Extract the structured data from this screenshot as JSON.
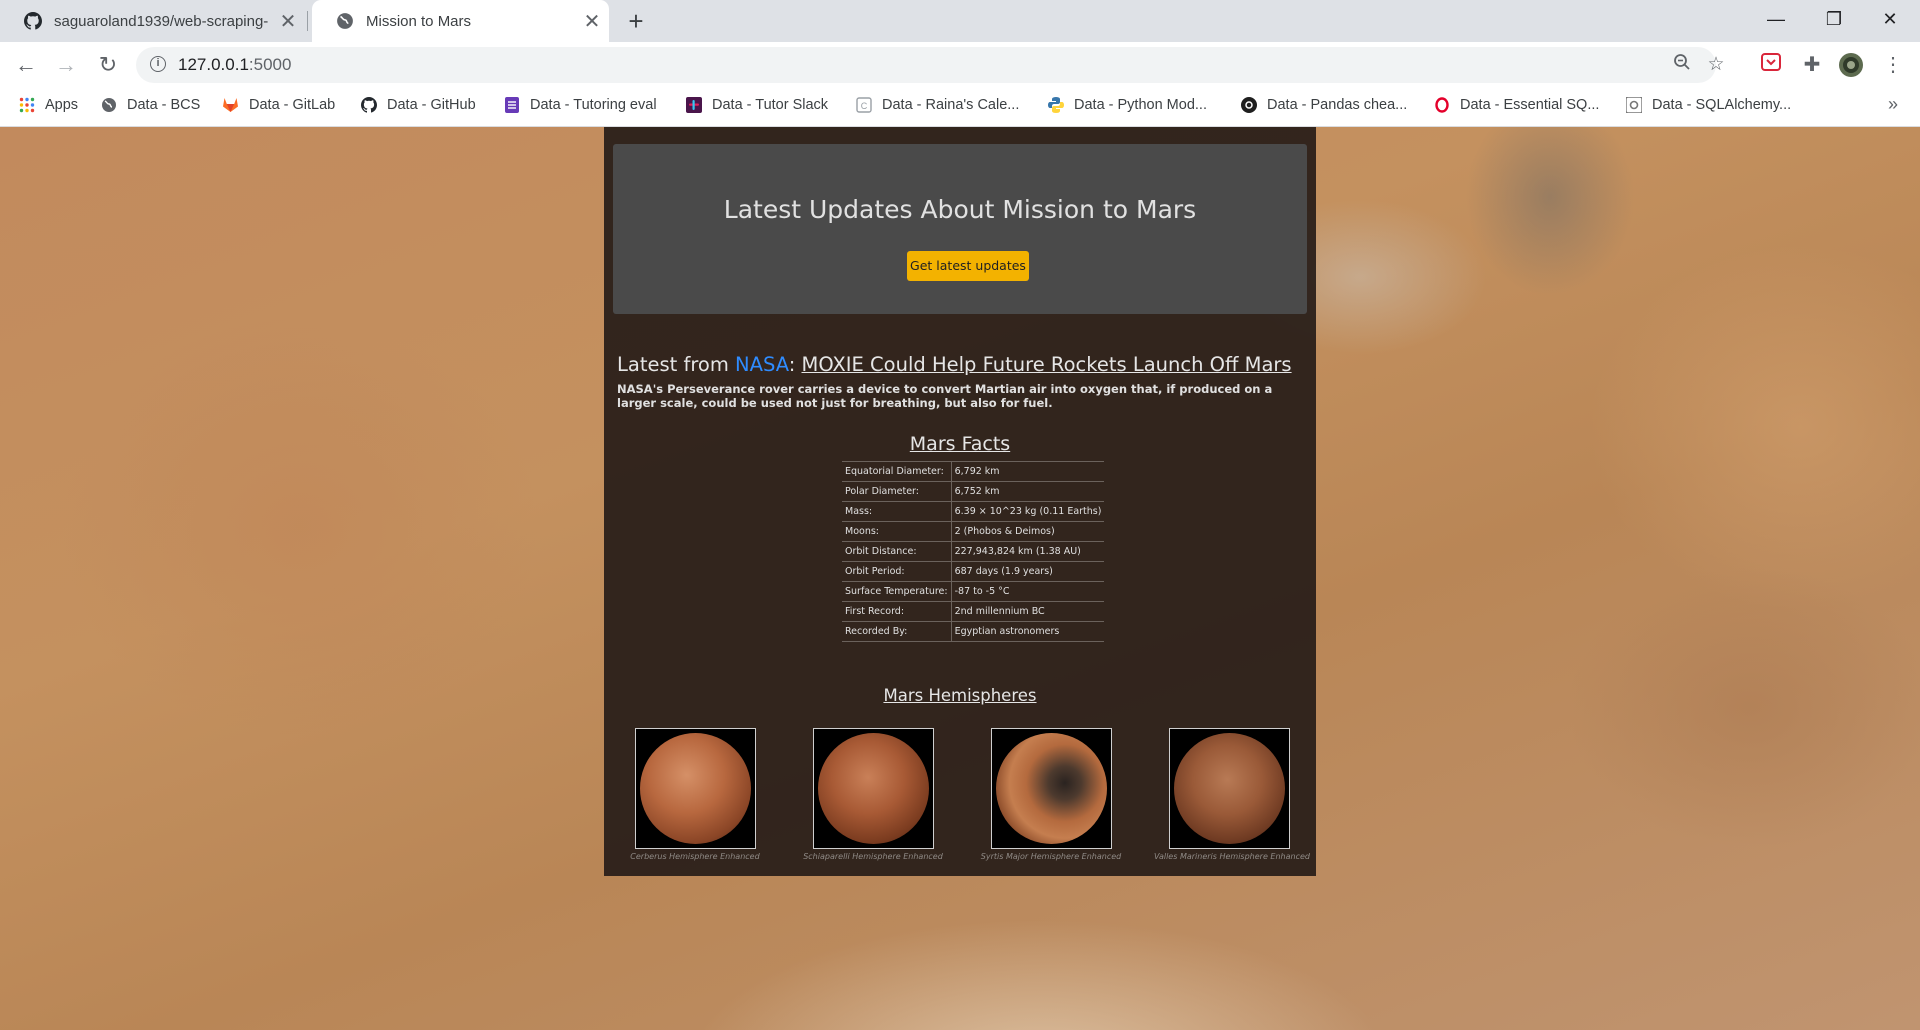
{
  "browser": {
    "tabs": [
      {
        "title": "saguaroland1939/web-scraping-",
        "icon": "github-icon",
        "active": false
      },
      {
        "title": "Mission to Mars",
        "icon": "globe-icon",
        "active": true
      }
    ],
    "new_tab": "+",
    "window_controls": {
      "minimize": "—",
      "restore": "❐",
      "close": "✕"
    },
    "url": "127.0.0.1",
    "url_port": ":5000",
    "bookmarks": [
      {
        "label": "Apps",
        "icon": "apps-grid-icon"
      },
      {
        "label": "Data - BCS",
        "icon": "globe-icon"
      },
      {
        "label": "Data - GitLab",
        "icon": "gitlab-icon"
      },
      {
        "label": "Data - GitHub",
        "icon": "github-icon"
      },
      {
        "label": "Data - Tutoring eval",
        "icon": "form-icon"
      },
      {
        "label": "Data - Tutor Slack",
        "icon": "slack-icon"
      },
      {
        "label": "Data - Raina's Cale...",
        "icon": "calendar-icon"
      },
      {
        "label": "Data - Python Mod...",
        "icon": "python-icon"
      },
      {
        "label": "Data - Pandas chea...",
        "icon": "pandas-icon"
      },
      {
        "label": "Data - Essential SQ...",
        "icon": "opera-icon"
      },
      {
        "label": "Data - SQLAlchemy...",
        "icon": "sqlalchemy-icon"
      }
    ],
    "more_bookmarks": "»"
  },
  "page": {
    "jumbotron_title": "Latest Updates About Mission to Mars",
    "update_button": "Get latest updates",
    "news": {
      "prefix": "Latest from ",
      "source": "NASA",
      "separator": ": ",
      "title": "MOXIE Could Help Future Rockets Launch Off Mars",
      "paragraph": "NASA's Perseverance rover carries a device to convert Martian air into oxygen that, if produced on a larger scale, could be used not just for breathing, but also for fuel."
    },
    "facts_title": "Mars Facts",
    "facts": [
      {
        "key": "Equatorial Diameter:",
        "value": "6,792 km"
      },
      {
        "key": "Polar Diameter:",
        "value": "6,752 km"
      },
      {
        "key": "Mass:",
        "value": "6.39 × 10^23 kg (0.11 Earths)"
      },
      {
        "key": "Moons:",
        "value": "2 (Phobos & Deimos)"
      },
      {
        "key": "Orbit Distance:",
        "value": "227,943,824 km (1.38 AU)"
      },
      {
        "key": "Orbit Period:",
        "value": "687 days (1.9 years)"
      },
      {
        "key": "Surface Temperature:",
        "value": "-87 to -5 °C"
      },
      {
        "key": "First Record:",
        "value": "2nd millennium BC"
      },
      {
        "key": "Recorded By:",
        "value": "Egyptian astronomers"
      }
    ],
    "hemispheres_title": "Mars Hemispheres",
    "hemispheres": [
      {
        "caption": "Cerberus Hemisphere Enhanced"
      },
      {
        "caption": "Schiaparelli Hemisphere Enhanced"
      },
      {
        "caption": "Syrtis Major Hemisphere Enhanced"
      },
      {
        "caption": "Valles Marineris Hemisphere Enhanced"
      }
    ]
  },
  "colors": {
    "button": "#f3b200",
    "nasa_link": "#2f8cff",
    "panel": "#261c18",
    "jumbotron": "#4a4a4a"
  }
}
